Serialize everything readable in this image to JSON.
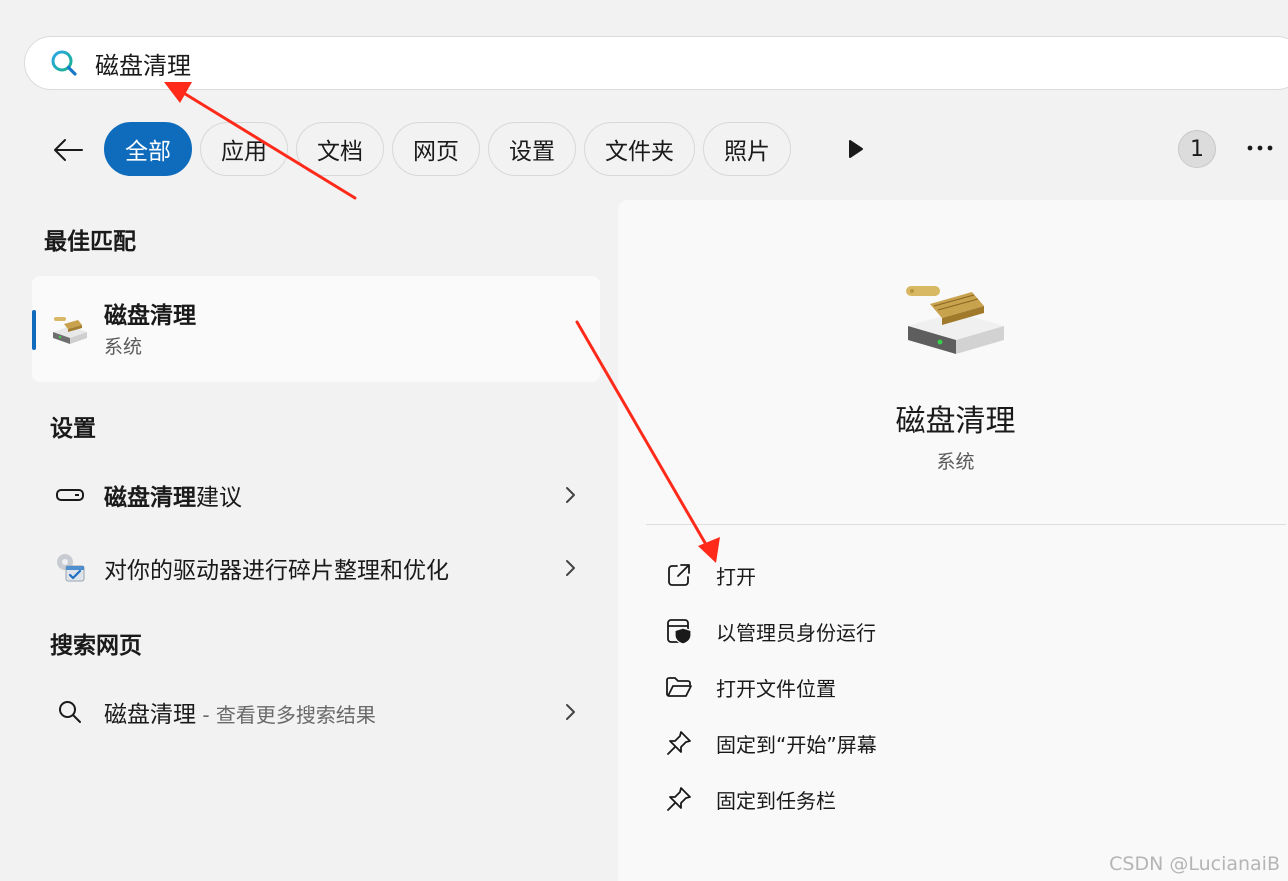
{
  "search": {
    "value": "磁盘清理",
    "icon": "search-icon"
  },
  "filters": {
    "items": [
      {
        "label": "全部",
        "active": true
      },
      {
        "label": "应用"
      },
      {
        "label": "文档"
      },
      {
        "label": "网页"
      },
      {
        "label": "设置"
      },
      {
        "label": "文件夹"
      },
      {
        "label": "照片"
      }
    ],
    "badge": "1"
  },
  "sections": {
    "best_match": "最佳匹配",
    "settings": "设置",
    "web": "搜索网页"
  },
  "best_match": {
    "name": "磁盘清理",
    "type": "系统"
  },
  "settings_items": [
    {
      "bold": "磁盘清理",
      "rest": "建议"
    },
    {
      "text": "对你的驱动器进行碎片整理和优化"
    }
  ],
  "web_item": {
    "term": "磁盘清理",
    "suffix": " - 查看更多搜索结果"
  },
  "detail": {
    "name": "磁盘清理",
    "type": "系统",
    "actions": [
      {
        "label": "打开",
        "icon": "open-external-icon"
      },
      {
        "label": "以管理员身份运行",
        "icon": "admin-shield-icon"
      },
      {
        "label": "打开文件位置",
        "icon": "folder-icon"
      },
      {
        "label": "固定到“开始”屏幕",
        "icon": "pin-icon"
      },
      {
        "label": "固定到任务栏",
        "icon": "pin-icon"
      }
    ]
  },
  "watermark": "CSDN @LucianaiB",
  "colors": {
    "accent": "#0f6cbd",
    "annotation_arrow": "#ff2a1a"
  }
}
